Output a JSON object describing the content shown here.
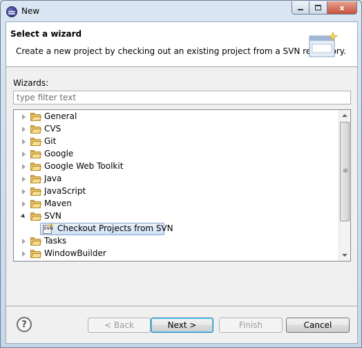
{
  "window": {
    "title": "New",
    "controls": {
      "minimize": "minimize",
      "maximize": "maximize",
      "close": "x"
    }
  },
  "header": {
    "title": "Select a wizard",
    "description": "Create a new project by checking out an existing project from a SVN repository."
  },
  "wizards": {
    "label": "Wizards:",
    "filter_placeholder": "type filter text",
    "filter_value": ""
  },
  "tree": {
    "items": [
      {
        "label": "General",
        "expanded": false
      },
      {
        "label": "CVS",
        "expanded": false
      },
      {
        "label": "Git",
        "expanded": false
      },
      {
        "label": "Google",
        "expanded": false
      },
      {
        "label": "Google Web Toolkit",
        "expanded": false
      },
      {
        "label": "Java",
        "expanded": false
      },
      {
        "label": "JavaScript",
        "expanded": false
      },
      {
        "label": "Maven",
        "expanded": false
      },
      {
        "label": "SVN",
        "expanded": true
      },
      {
        "label": "Tasks",
        "expanded": false
      },
      {
        "label": "WindowBuilder",
        "expanded": false
      }
    ],
    "svn_child": {
      "label": "Checkout Projects from SVN",
      "selected": true,
      "icon_text": "SVN"
    }
  },
  "buttons": {
    "help": "?",
    "back": "< Back",
    "next": "Next >",
    "finish": "Finish",
    "cancel": "Cancel"
  },
  "icons": {
    "app": "eclipse-icon",
    "folder": "folder-icon",
    "svn_wizard": "svn-checkout-icon",
    "header_graphic": "wizard-banner-icon"
  }
}
